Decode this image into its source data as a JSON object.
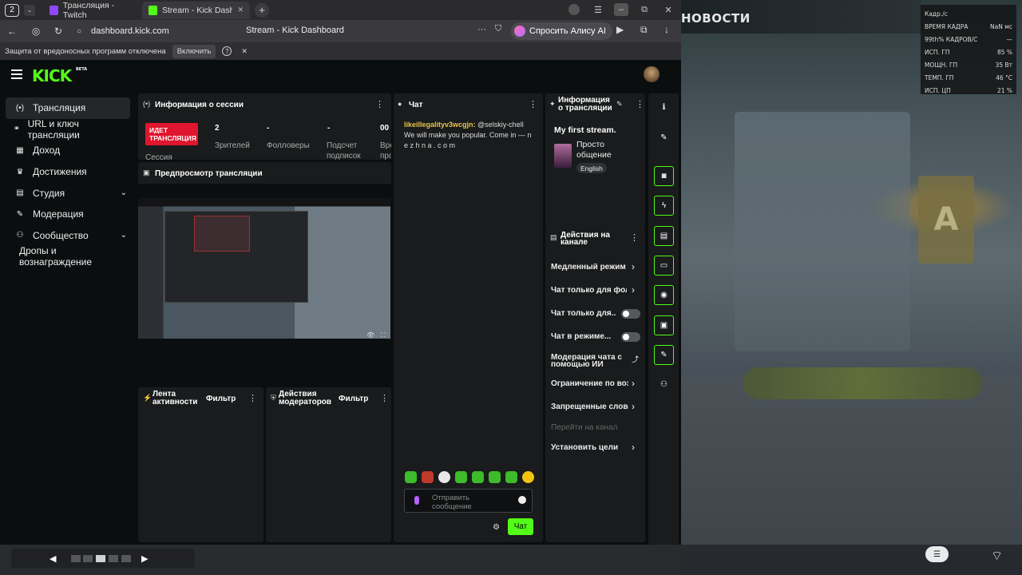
{
  "game": {
    "news_label": "НОВОСТИ",
    "perf": [
      {
        "label": "Кадр./с",
        "value": ""
      },
      {
        "label": "ВРЕМЯ КАДРА",
        "value": "NaN мс"
      },
      {
        "label": "99th% КАДРОВ/С",
        "value": "—"
      },
      {
        "label": "ИСП. ГП",
        "value": "85 %"
      },
      {
        "label": "МОЩН. ГП",
        "value": "35 Вт"
      },
      {
        "label": "ТЕМП. ГП",
        "value": "46 °C"
      },
      {
        "label": "ИСП. ЦП",
        "value": "21 %"
      }
    ]
  },
  "browser": {
    "tab_count": "2",
    "tabs": [
      {
        "title": "Трансляция - Twitch",
        "color": "#9147ff"
      },
      {
        "title": "Stream - Kick Dashb",
        "color": "#53fc18"
      }
    ],
    "url": "dashboard.kick.com",
    "page_title": "Stream - Kick Dashboard",
    "alice_label": "Спросить Алису AI",
    "protection_text": "Защита от вредоносных программ отключена",
    "protection_button": "Включить"
  },
  "kick": {
    "logo": "KICK",
    "beta": "BETA",
    "sidebar": [
      {
        "label": "Трансляция",
        "icon": "(•)",
        "active": true
      },
      {
        "label": "URL и ключ трансляции",
        "icon": "🔗"
      },
      {
        "label": "Доход",
        "icon": "▦"
      },
      {
        "label": "Достижения",
        "icon": "🏆"
      },
      {
        "label": "Студия",
        "icon": "▤",
        "chevron": true
      },
      {
        "label": "Модерация",
        "icon": "🔧"
      },
      {
        "label": "Сообщество",
        "icon": "👥",
        "chevron": true
      },
      {
        "label": "Дропы и вознаграждение",
        "icon": ""
      }
    ],
    "session": {
      "title": "Информация о сессии",
      "live_badge": "ИДЕТ ТРАНСЛЯЦИЯ",
      "session_label": "Сессия",
      "stats": [
        {
          "value": "2",
          "label": "Зрителей"
        },
        {
          "value": "-",
          "label": "Фолловеры"
        },
        {
          "value": "-",
          "label": "Подсчет подписок"
        },
        {
          "value": "00",
          "label": "Вре про"
        }
      ]
    },
    "preview": {
      "title": "Предпросмотр трансляции"
    },
    "activity": {
      "title": "Лента активности",
      "filter": "Фильтр"
    },
    "mod_actions": {
      "title": "Действия модераторов",
      "filter": "Фильтр"
    },
    "chat": {
      "title": "Чат",
      "messages": [
        {
          "user": "likeillegalityv3wcgjn:",
          "text": " @selskiy-chell We will make you popular. Come in — n e z h n a . c o m"
        }
      ],
      "input_placeholder": "Отправить сообщение",
      "send_label": "Чат"
    },
    "stream_info": {
      "title": "Информация о трансляции",
      "stream_title": "My first stream.",
      "category": "Просто общение",
      "language": "English"
    },
    "channel_actions": {
      "title": "Действия на канале",
      "items": [
        {
          "label": "Медленный режим",
          "control": "chevron"
        },
        {
          "label": "Чат только для фолл",
          "control": "chevron"
        },
        {
          "label": "Чат только для...",
          "control": "toggle"
        },
        {
          "label": "Чат в режиме...",
          "control": "toggle"
        },
        {
          "label": "Модерация чата с помощью ИИ",
          "control": "external"
        },
        {
          "label": "Ограничение по возр",
          "control": "chevron"
        },
        {
          "label": "Запрещенные слова",
          "control": "chevron"
        },
        {
          "label": "Перейти на канал",
          "control": "disabled"
        },
        {
          "label": "Установить цели",
          "control": "chevron"
        }
      ]
    }
  }
}
